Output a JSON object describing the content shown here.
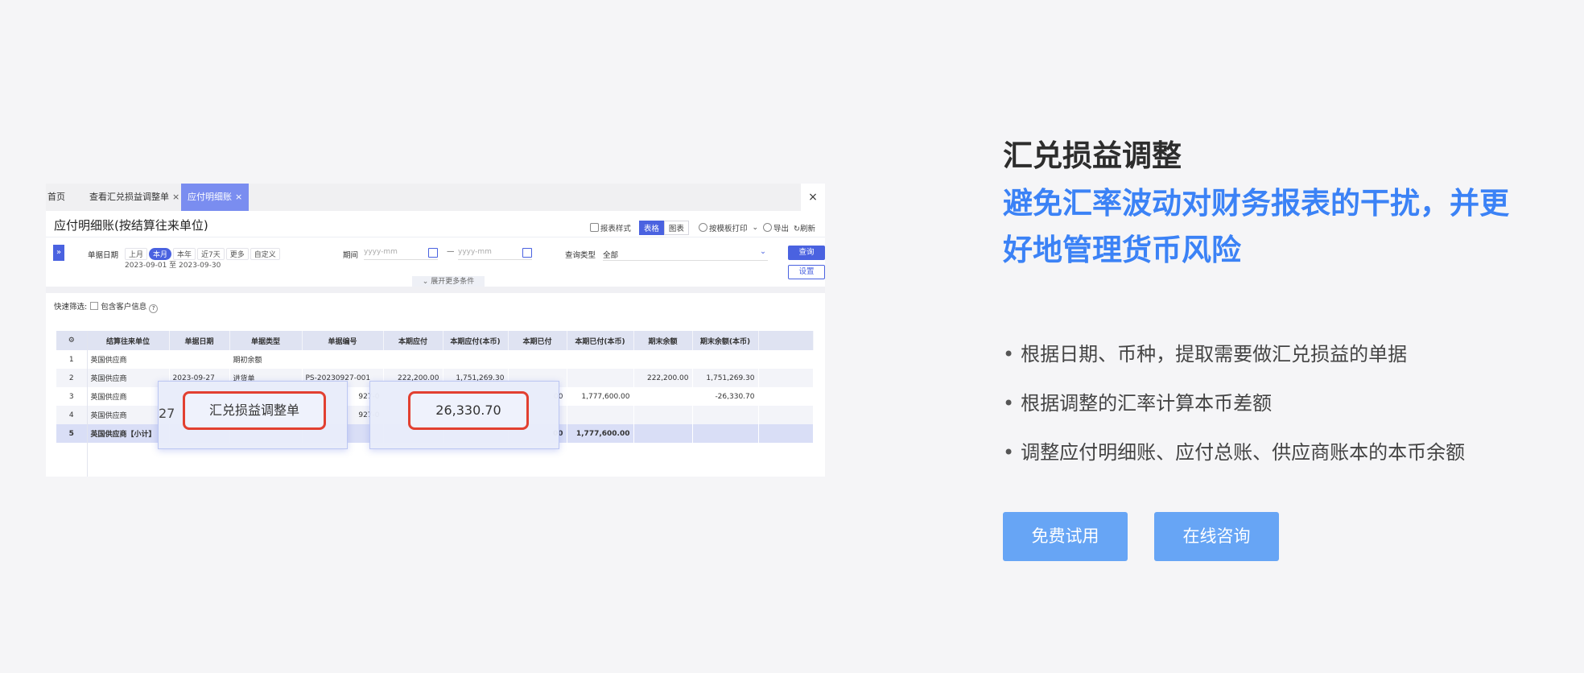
{
  "screenshot": {
    "tabs": [
      {
        "label": "首页",
        "closable": false
      },
      {
        "label": "查看汇兑损益调整单",
        "closable": true
      },
      {
        "label": "应付明细账",
        "closable": true,
        "active": true
      }
    ],
    "close_icon": "×",
    "tab_close_glyph": "×",
    "page_title": "应付明细账(按结算往来单位)",
    "toolbar": {
      "report_style": "报表样式",
      "view_table": "表格",
      "view_chart": "图表",
      "print_template": "按模板打印",
      "export": "导出",
      "refresh": "刷新"
    },
    "filters": {
      "expand_glyph": "»",
      "doc_date_label": "单据日期",
      "date_chips": [
        "上月",
        "本月",
        "本年",
        "近7天",
        "更多",
        "自定义"
      ],
      "active_chip": "本月",
      "date_range": "2023-09-01 至 2023-09-30",
      "period_label": "期间",
      "period_placeholder_start": "yyyy-mm",
      "period_separator": "—",
      "period_placeholder_end": "yyyy-mm",
      "query_type_label": "查询类型",
      "query_type_value": "全部",
      "query_button": "查询",
      "settings_button": "设置",
      "more_conditions": "展开更多条件"
    },
    "quick_filter": {
      "label": "快速筛选:",
      "checkbox_label": "包含客户信息",
      "help_glyph": "?"
    },
    "table": {
      "settings_glyph": "⚙",
      "columns": [
        "结算往来单位",
        "单据日期",
        "单据类型",
        "单据编号",
        "本期应付",
        "本期应付(本币)",
        "本期已付",
        "本期已付(本币)",
        "期末余额",
        "期末余额(本币)"
      ],
      "rows": [
        [
          "1",
          "英国供应商",
          "",
          "期初余额",
          "",
          "",
          "",
          "",
          "",
          "",
          ""
        ],
        [
          "2",
          "英国供应商",
          "2023-09-27",
          "进货单",
          "PS-20230927-001",
          "222,200.00",
          "1,751,269.30",
          "",
          "",
          "222,200.00",
          "1,751,269.30"
        ],
        [
          "3",
          "英国供应商",
          "",
          "",
          "927-0",
          "",
          "",
          "00",
          "1,777,600.00",
          "",
          "-26,330.70"
        ],
        [
          "4",
          "英国供应商",
          "",
          "",
          "927-0",
          "",
          "",
          "",
          "",
          "",
          ""
        ],
        [
          "5",
          "英国供应商【小计】",
          "",
          "",
          "",
          "",
          "",
          "00",
          "1,777,600.00",
          "",
          ""
        ]
      ]
    },
    "popups": {
      "left_fragment": "27",
      "doc_callout": "汇兑损益调整单",
      "amount_callout": "26,330.70"
    }
  },
  "feature": {
    "title": "汇兑损益调整",
    "subtitle": "避免汇率波动对财务报表的干扰，并更好地管理货币风险",
    "bullets": [
      "根据日期、币种，提取需要做汇兑损益的单据",
      "根据调整的汇率计算本币差额",
      "调整应付明细账、应付总账、供应商账本的本币余额"
    ],
    "buttons": {
      "trial": "免费试用",
      "consult": "在线咨询"
    }
  },
  "colors": {
    "accent_blue": "#3b82f6",
    "button_blue": "#67a5f5",
    "callout_red": "#e24030",
    "app_primary": "#4a62e0"
  }
}
